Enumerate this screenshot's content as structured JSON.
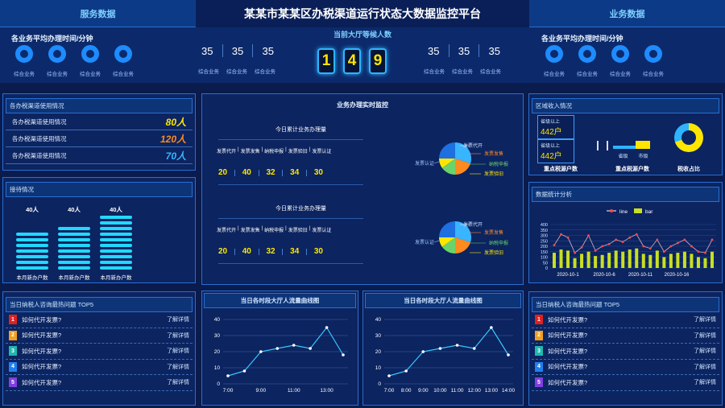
{
  "header": {
    "title": "某某市某某区办税渠道运行状态大数据监控平台",
    "left_tab": "服务数据",
    "right_tab": "业务数据"
  },
  "left_top": {
    "subtitle": "各业务平均办理时间/分钟",
    "rings": [
      "综合业务",
      "综合业务",
      "综合业务",
      "综合业务"
    ]
  },
  "right_top": {
    "subtitle": "各业务平均办理时间/分钟",
    "rings": [
      "综合业务",
      "综合业务",
      "综合业务",
      "综合业务"
    ]
  },
  "center_top": {
    "waiting_label": "当前大厅等候人数",
    "waiting_digits": [
      "1",
      "4",
      "9"
    ],
    "left_nums": [
      "35",
      "35",
      "35"
    ],
    "left_labels": [
      "综合业务",
      "综合业务",
      "综合业务"
    ],
    "right_nums": [
      "35",
      "35",
      "35"
    ],
    "right_labels": [
      "综合业务",
      "综合业务",
      "综合业务"
    ]
  },
  "channels": {
    "title": "各办税渠道使用情况",
    "rows": [
      {
        "label": "各办税渠道使用情况",
        "value": "80人",
        "color": "#ffe600"
      },
      {
        "label": "各办税渠道使用情况",
        "value": "120人",
        "color": "#ff8a1e"
      },
      {
        "label": "各办税渠道使用情况",
        "value": "70人",
        "color": "#39b4ff"
      }
    ]
  },
  "reception": {
    "title": "接待情况",
    "cols": [
      {
        "value": "40人",
        "label": "本月新办户数",
        "bars": 7
      },
      {
        "value": "40人",
        "label": "本月新办户数",
        "bars": 8
      },
      {
        "value": "40人",
        "label": "本月新办户数",
        "bars": 10
      }
    ]
  },
  "realtime": {
    "title": "业务办理实时监控",
    "blocks": [
      {
        "subtitle": "今日累计业务办理量",
        "headers": [
          "发票代开",
          "发票发售",
          "纳税申报",
          "发票验旧",
          "发票认证"
        ],
        "values": [
          "20",
          "40",
          "32",
          "34",
          "30"
        ],
        "pie_labels": {
          "a": "发票代开",
          "b": "发票发售",
          "c": "纳税申报",
          "d": "发票验旧",
          "e": "发票认证"
        }
      },
      {
        "subtitle": "今日累计业务办理量",
        "headers": [
          "发票代开",
          "发票发售",
          "纳税申报",
          "发票验旧",
          "发票认证"
        ],
        "values": [
          "20",
          "40",
          "32",
          "34",
          "30"
        ],
        "pie_labels": {
          "a": "发票代开",
          "b": "发票发售",
          "c": "纳税申报",
          "d": "发票验旧",
          "e": "发票认证"
        }
      }
    ]
  },
  "region": {
    "title": "区域收入情况",
    "box1_label": "省级以上",
    "box1_value": "442户",
    "box2_label": "省级以上",
    "box2_value": "442户",
    "caption1": "重点税源户数",
    "mini_bars": [
      "省级",
      "市级"
    ],
    "caption2": "重点税源户数",
    "caption3": "税收占比"
  },
  "stats": {
    "title": "数据统计分析",
    "legend": [
      "line",
      "bar"
    ],
    "y_ticks": [
      "400",
      "350",
      "300",
      "250",
      "200",
      "150",
      "100",
      "50",
      "0"
    ],
    "x_ticks": [
      "2020-10-1",
      "2020-10-6",
      "2020-10-11",
      "2020-10-16"
    ]
  },
  "chart_data": [
    {
      "type": "line",
      "title": "当日各时段大厅人流量曲线图",
      "x": [
        "7:00",
        "8:00",
        "9:00",
        "10:00",
        "11:00",
        "12:00",
        "13:00",
        "14:00"
      ],
      "values": [
        5,
        8,
        20,
        22,
        24,
        22,
        35,
        18
      ],
      "x_tick_labels": [
        "7:00",
        "9:00",
        "11:00",
        "13:00"
      ],
      "ylim": [
        0,
        40
      ],
      "y_ticks": [
        0,
        10,
        20,
        30,
        40
      ]
    },
    {
      "type": "line",
      "title": "当日各时段大厅人流量曲线图",
      "x": [
        "7:00",
        "8:00",
        "9:00",
        "10:00",
        "11:00",
        "12:00",
        "13:00",
        "14:00"
      ],
      "values": [
        5,
        8,
        20,
        22,
        24,
        22,
        35,
        18
      ],
      "x_tick_labels": [
        "7:00",
        "8:00",
        "9:00",
        "10:00",
        "11:00",
        "12:00",
        "13:00",
        "14:00"
      ],
      "ylim": [
        0,
        40
      ],
      "y_ticks": [
        0,
        10,
        20,
        30,
        40
      ]
    },
    {
      "type": "bar+line",
      "title": "数据统计分析",
      "series": [
        {
          "name": "line",
          "values": [
            210,
            310,
            280,
            140,
            190,
            300,
            160,
            200,
            220,
            260,
            240,
            280,
            310,
            200,
            180,
            260,
            150,
            200,
            230,
            260,
            200,
            150,
            140,
            260
          ]
        },
        {
          "name": "bar",
          "values": [
            140,
            170,
            160,
            90,
            130,
            150,
            110,
            120,
            140,
            160,
            150,
            170,
            180,
            130,
            120,
            160,
            100,
            130,
            140,
            150,
            130,
            100,
            90,
            150
          ]
        }
      ],
      "ylim": [
        0,
        400
      ]
    },
    {
      "type": "pie",
      "title": "",
      "values": [
        30,
        20,
        15,
        10,
        25
      ],
      "colors": [
        "#39b4ff",
        "#ff8a1e",
        "#6bd36b",
        "#ffe600",
        "#1e6fe0"
      ]
    }
  ],
  "hot_left": {
    "title": "当日纳税人咨询最热问题 TOP5",
    "items": [
      {
        "n": "1",
        "q": "如何代开发票?",
        "more": "了解详情",
        "color": "#e02020"
      },
      {
        "n": "2",
        "q": "如何代开发票?",
        "more": "了解详情",
        "color": "#f0a020"
      },
      {
        "n": "3",
        "q": "如何代开发票?",
        "more": "了解详情",
        "color": "#20b8b0"
      },
      {
        "n": "4",
        "q": "如何代开发票?",
        "more": "了解详情",
        "color": "#2080f0"
      },
      {
        "n": "5",
        "q": "如何代开发票?",
        "more": "了解详情",
        "color": "#8040e0"
      }
    ]
  },
  "hot_right": {
    "title": "当日纳税人咨询最热问题 TOP5",
    "items": [
      {
        "n": "1",
        "q": "如何代开发票?",
        "more": "了解详情",
        "color": "#e02020"
      },
      {
        "n": "2",
        "q": "如何代开发票?",
        "more": "了解详情",
        "color": "#f0a020"
      },
      {
        "n": "3",
        "q": "如何代开发票?",
        "more": "了解详情",
        "color": "#20b8b0"
      },
      {
        "n": "4",
        "q": "如何代开发票?",
        "more": "了解详情",
        "color": "#2080f0"
      },
      {
        "n": "5",
        "q": "如何代开发票?",
        "more": "了解详情",
        "color": "#8040e0"
      }
    ]
  }
}
